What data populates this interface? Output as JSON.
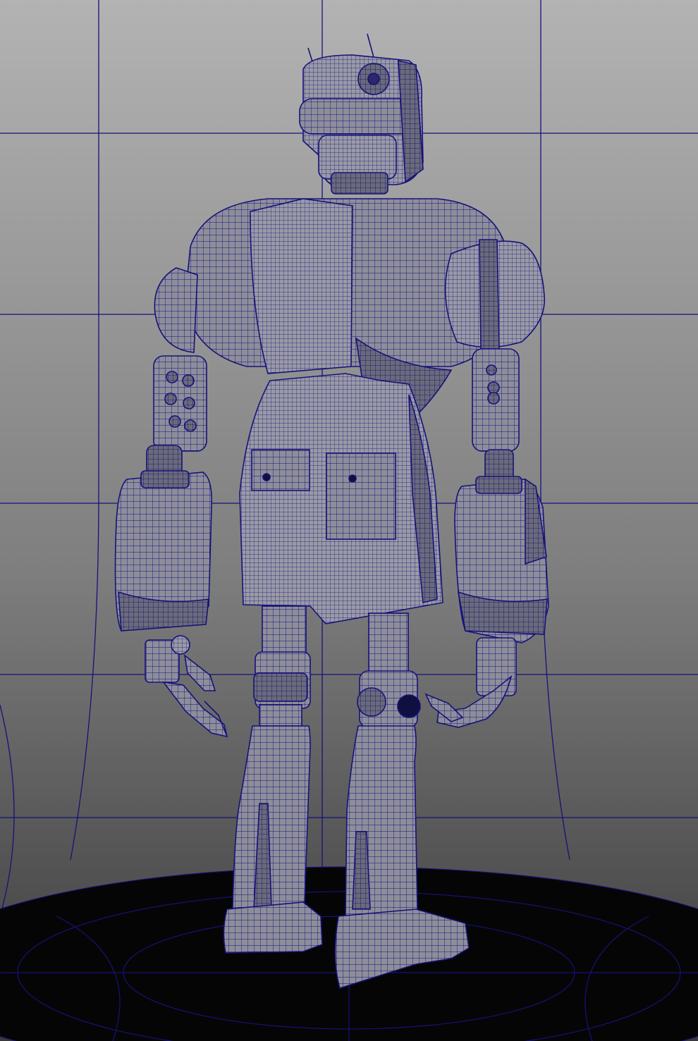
{
  "viewport": {
    "background_top": "#b3b3b3",
    "background_bottom": "#3a3a3a",
    "wire_color": "#16127a",
    "mesh_fill": "#8e8e9a",
    "mesh_dark": "#55556a",
    "floor_color": "#050505"
  },
  "scene": {
    "object": "robot-wireframe-model",
    "view": "perspective-back"
  }
}
